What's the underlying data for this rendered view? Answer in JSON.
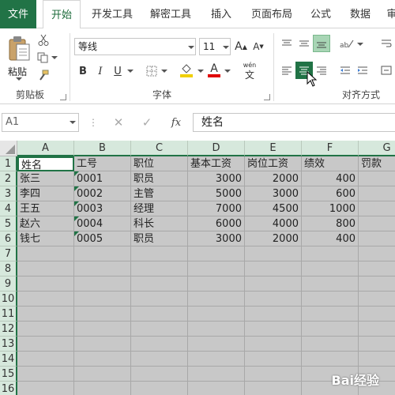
{
  "tabs": [
    "文件",
    "开始",
    "开发工具",
    "解密工具",
    "插入",
    "页面布局",
    "公式",
    "数据",
    "审"
  ],
  "ribbon": {
    "paste_label": "粘贴",
    "clipboard_label": "剪贴板",
    "font_name": "等线",
    "font_size": "11",
    "grow_font": "A",
    "shrink_font": "A",
    "bold": "B",
    "italic": "I",
    "underline": "U",
    "font_color_letter": "A",
    "wen_top": "wén",
    "wen_bottom": "文",
    "font_group_label": "字体",
    "align_group_label": "对齐方式"
  },
  "formula_bar": {
    "name_box": "A1",
    "fx": "fx",
    "content": "姓名"
  },
  "columns": [
    "A",
    "B",
    "C",
    "D",
    "E",
    "F",
    "G"
  ],
  "rows": [
    "1",
    "2",
    "3",
    "4",
    "5",
    "6",
    "7",
    "8",
    "9",
    "10",
    "11",
    "12",
    "13",
    "14",
    "15",
    "16"
  ],
  "table": [
    [
      "姓名",
      "工号",
      "职位",
      "基本工资",
      "岗位工资",
      "绩效",
      "罚款"
    ],
    [
      "张三",
      "0001",
      "职员",
      "3000",
      "2000",
      "400",
      ""
    ],
    [
      "李四",
      "0002",
      "主管",
      "5000",
      "3000",
      "600",
      ""
    ],
    [
      "王五",
      "0003",
      "经理",
      "7000",
      "4500",
      "1000",
      ""
    ],
    [
      "赵六",
      "0004",
      "科长",
      "6000",
      "4000",
      "800",
      ""
    ],
    [
      "钱七",
      "0005",
      "职员",
      "3000",
      "2000",
      "400",
      ""
    ]
  ],
  "watermark": "Bai经验",
  "colors": {
    "accent": "#217346",
    "header_bg": "#d6e8dc",
    "selection": "#c8c8c8"
  }
}
